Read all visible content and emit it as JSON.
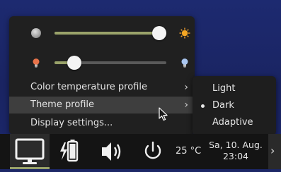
{
  "popup": {
    "brightness_slider": {
      "value_percent": 100
    },
    "color_temp_slider": {
      "value_percent": 18
    },
    "items": [
      {
        "label": "Color temperature profile",
        "chevron": "›"
      },
      {
        "label": "Theme profile",
        "chevron": "›"
      },
      {
        "label": "Display settings..."
      }
    ]
  },
  "submenu": {
    "items": [
      {
        "label": "Light",
        "selected": false
      },
      {
        "label": "Dark",
        "selected": true
      },
      {
        "label": "Adaptive",
        "selected": false
      }
    ]
  },
  "taskbar": {
    "temperature": "25 °C",
    "date": "Sa, 10. Aug.",
    "time": "23:04",
    "overflow_chevron": "›"
  },
  "colors": {
    "accent": "#9aa36a",
    "popup_bg": "#202020",
    "taskbar_bg": "#141414",
    "desktop_bg": "#1c2766"
  },
  "icons": {
    "brightness_low": "moon-gray-icon",
    "brightness_high": "sun-orange-icon",
    "temp_warm": "bulb-warm-icon",
    "temp_cool": "bulb-cool-icon",
    "display": "monitor-icon",
    "battery": "battery-charging-icon",
    "volume": "speaker-icon",
    "power": "power-icon"
  }
}
